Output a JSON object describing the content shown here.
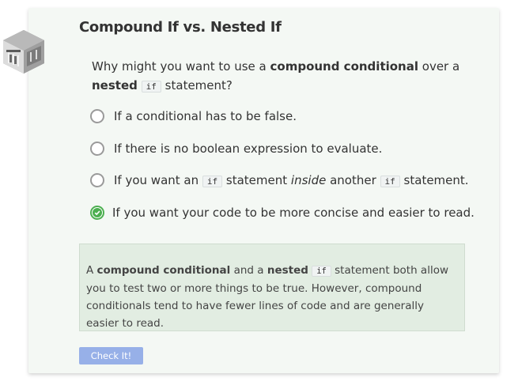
{
  "title": "Compound If vs. Nested If",
  "question": {
    "prefix": "Why might you want to use a ",
    "bold1": "compound conditional",
    "mid": " over a ",
    "bold2": "nested",
    "code": "if",
    "suffix": " statement?"
  },
  "options": [
    {
      "text": "If a conditional has to be false.",
      "selected": false
    },
    {
      "text": "If there is no boolean expression to evaluate.",
      "selected": false
    },
    {
      "parts": {
        "a": "If you want an ",
        "code1": "if",
        "b": " statement ",
        "em": "inside",
        "c": " another ",
        "code2": "if",
        "d": " statement."
      },
      "selected": false
    },
    {
      "text": "If you want your code to be more concise and easier to read.",
      "selected": true
    }
  ],
  "feedback": {
    "a": "A ",
    "bold1": "compound conditional",
    "b": " and a ",
    "bold2": "nested",
    "code": "if",
    "c": " statement both allow you to test two or more things to be true. However, compound conditionals tend to have fewer lines of code and are generally easier to read."
  },
  "check_button": "Check It!",
  "colors": {
    "accent_green": "#4caf50",
    "button_blue": "#97b0e8",
    "feedback_bg": "#e2ede2"
  },
  "icons": {
    "logo": "bridge-cube-logo-icon",
    "check": "check-icon"
  }
}
